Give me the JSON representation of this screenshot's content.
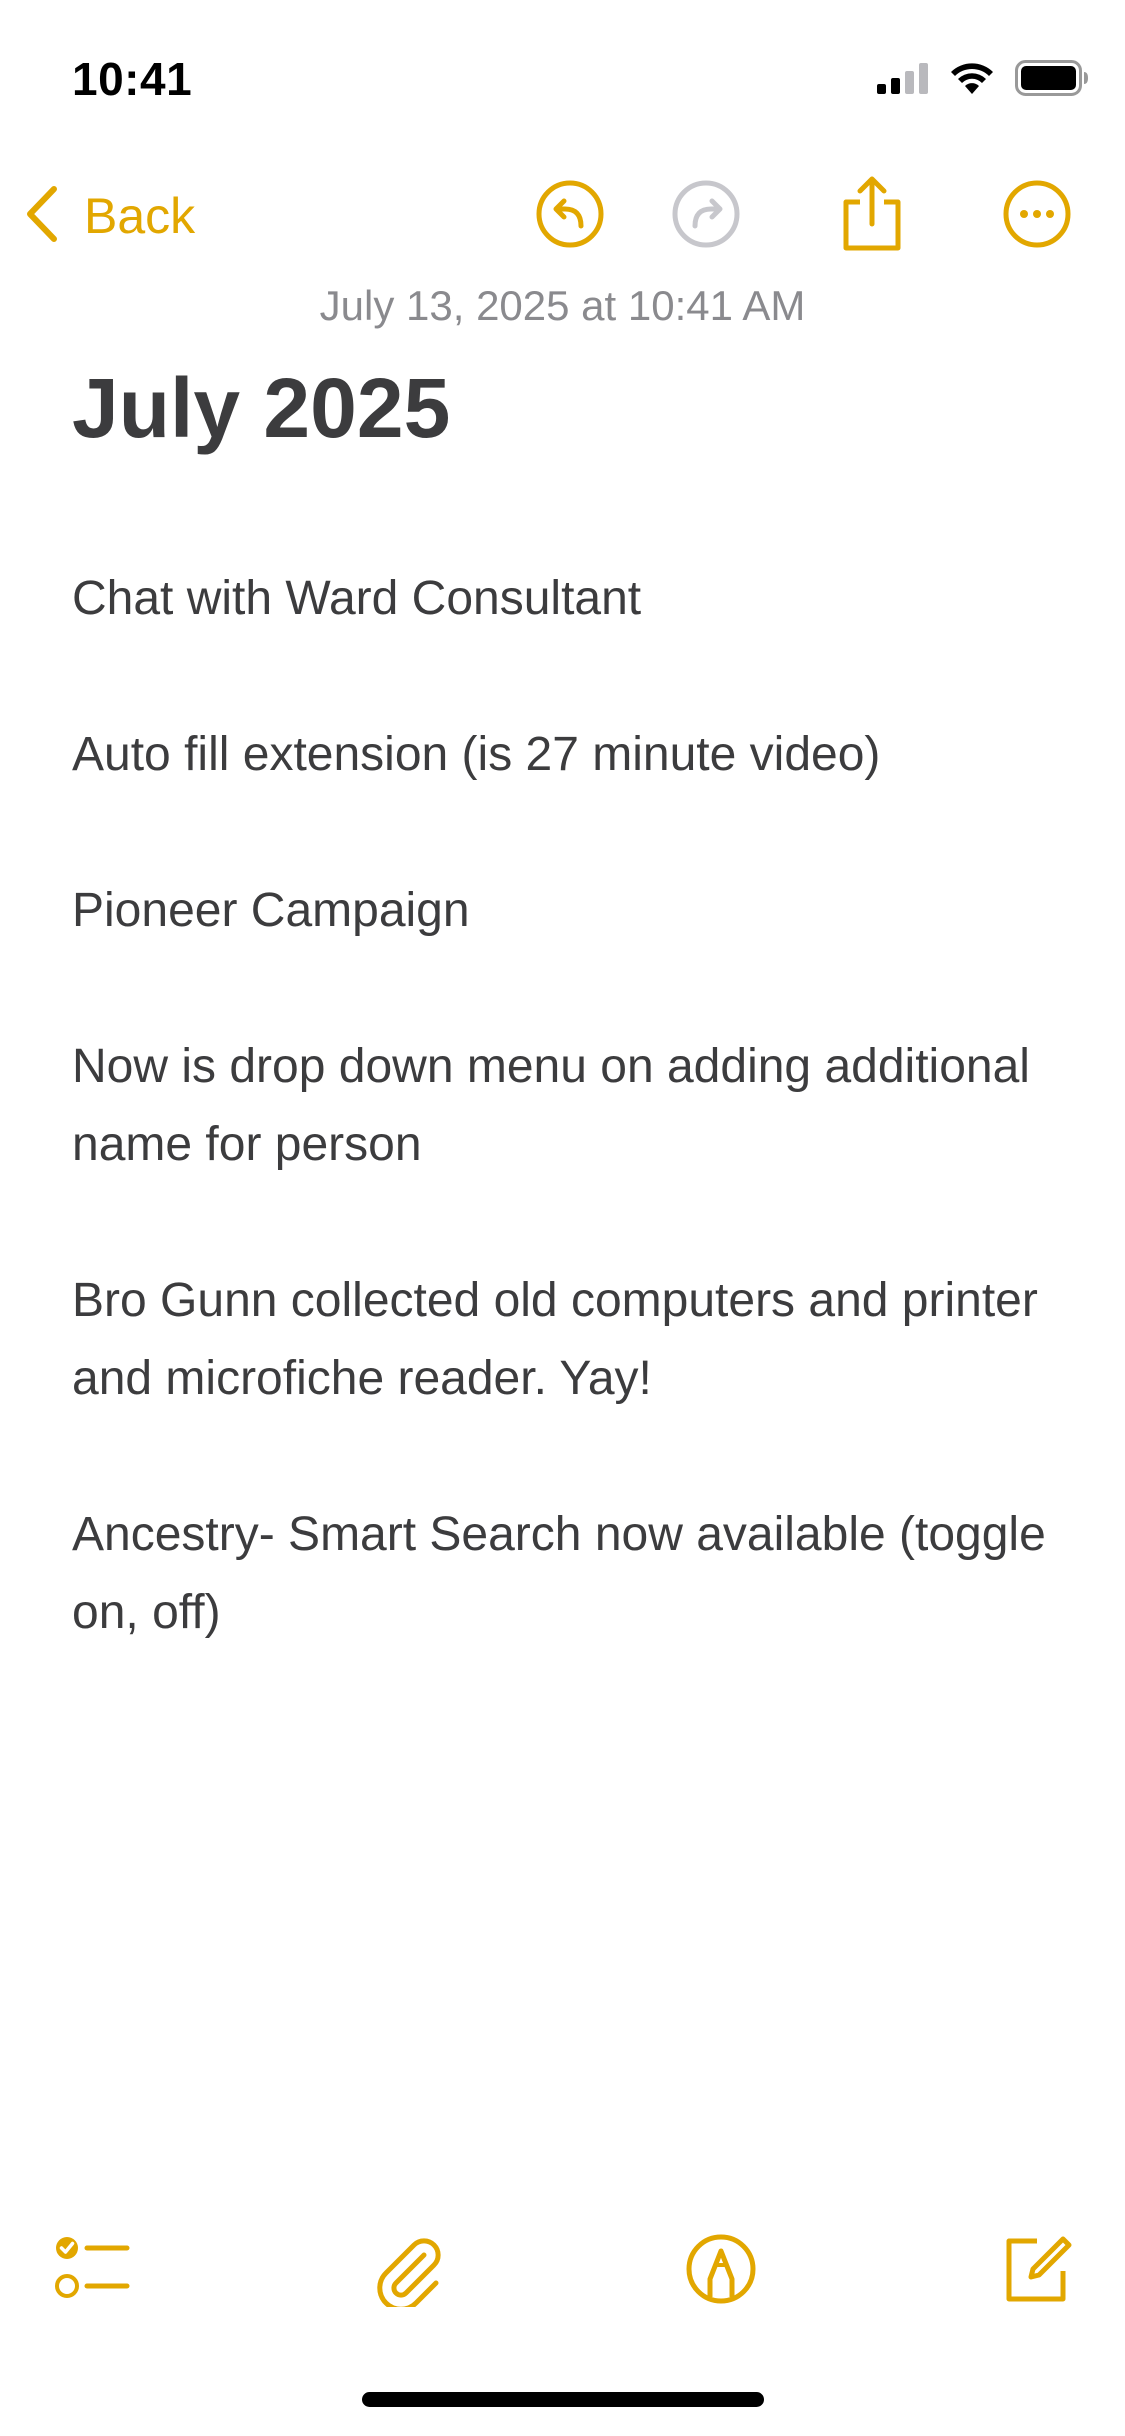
{
  "status_bar": {
    "time": "10:41",
    "icons": [
      "cellular-signal-icon",
      "wifi-icon",
      "battery-icon"
    ]
  },
  "nav": {
    "back_label": "Back",
    "icons": [
      "chevron-left-icon",
      "undo-icon",
      "redo-icon",
      "share-icon",
      "more-icon"
    ]
  },
  "note": {
    "timestamp": "July 13, 2025 at 10:41 AM",
    "title": "July 2025",
    "paragraphs": [
      "Chat with Ward Consultant",
      "Auto fill extension (is 27 minute video)",
      "Pioneer Campaign",
      "Now is drop down menu on adding additional name for person",
      "Bro Gunn collected old computers and printer and microfiche reader. Yay!",
      "Ancestry- Smart Search now available (toggle on, off)"
    ]
  },
  "bottom_toolbar": {
    "icons": [
      "checklist-icon",
      "paperclip-icon",
      "markup-pen-icon",
      "compose-icon"
    ]
  },
  "colors": {
    "accent": "#e2a700",
    "disabled": "#c7c7cc",
    "text": "#3c3c3e",
    "secondary_text": "#8a8a8e"
  }
}
